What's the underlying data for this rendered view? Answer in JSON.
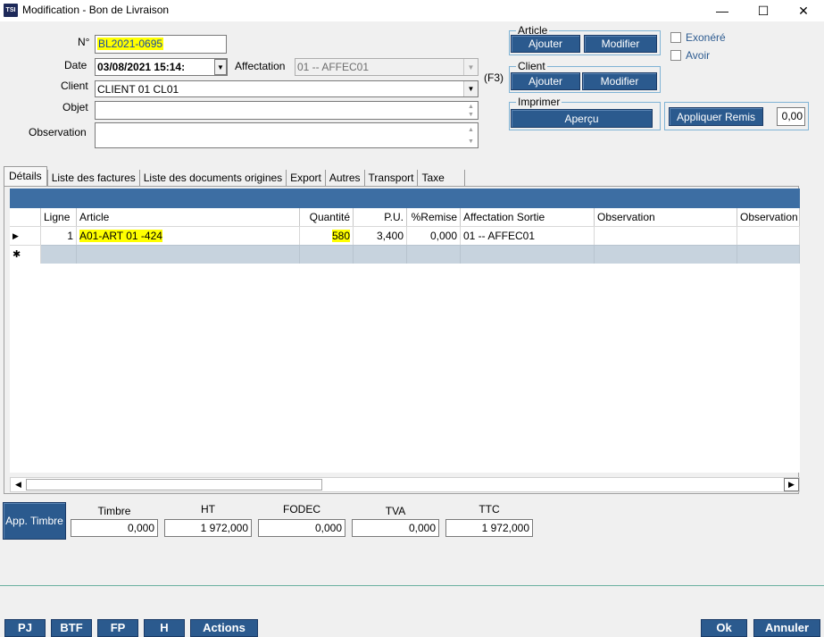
{
  "window": {
    "title": "Modification - Bon de Livraison",
    "icon_text": "TSI",
    "minimize": "—",
    "maximize": "☐",
    "close": "✕"
  },
  "form": {
    "no_label": "N°",
    "no_value": "BL2021-0695",
    "date_label": "Date",
    "date_value": "03/08/2021 15:14:",
    "affectation_label": "Affectation",
    "affectation_value": "01 -- AFFEC01",
    "client_label": "Client",
    "client_value": "CLIENT 01 CL01",
    "objet_label": "Objet",
    "objet_value": "",
    "observation_label": "Observation",
    "observation_value": "",
    "f3_label": "(F3)"
  },
  "article_group": {
    "title": "Article",
    "ajouter": "Ajouter",
    "modifier": "Modifier"
  },
  "client_group": {
    "title": "Client",
    "ajouter": "Ajouter",
    "modifier": "Modifier"
  },
  "imprimer_group": {
    "title": "Imprimer",
    "apercu": "Aperçu"
  },
  "checks": {
    "exonere": "Exonéré",
    "avoir": "Avoir"
  },
  "remise": {
    "button": "Appliquer Remis",
    "value": "0,00"
  },
  "tabs": [
    "Détails",
    "Liste des factures",
    "Liste des documents origines",
    "Export",
    "Autres",
    "Transport",
    "Taxe"
  ],
  "grid": {
    "columns": [
      "Ligne",
      "Article",
      "Quantité",
      "P.U.",
      "%Remise",
      "Affectation Sortie",
      "Observation",
      "Observation"
    ],
    "rows": [
      {
        "ligne": "1",
        "article": "A01-ART 01 -424",
        "quantite": "580",
        "pu": "3,400",
        "remise": "0,000",
        "affectation": "01 -- AFFEC01",
        "obs1": "",
        "obs2": ""
      }
    ],
    "row_marker": "▶",
    "new_marker": "✱"
  },
  "totals": {
    "app_timbre": "App. Timbre",
    "timbre_label": "Timbre",
    "timbre_value": "0,000",
    "ht_label": "HT",
    "ht_value": "1 972,000",
    "fodec_label": "FODEC",
    "fodec_value": "0,000",
    "tva_label": "TVA",
    "tva_value": "0,000",
    "ttc_label": "TTC",
    "ttc_value": "1 972,000"
  },
  "bottom_buttons": {
    "pj": "PJ",
    "btf": "BTF",
    "fp": "FP",
    "h": "H",
    "actions": "Actions",
    "ok": "Ok",
    "annuler": "Annuler"
  }
}
